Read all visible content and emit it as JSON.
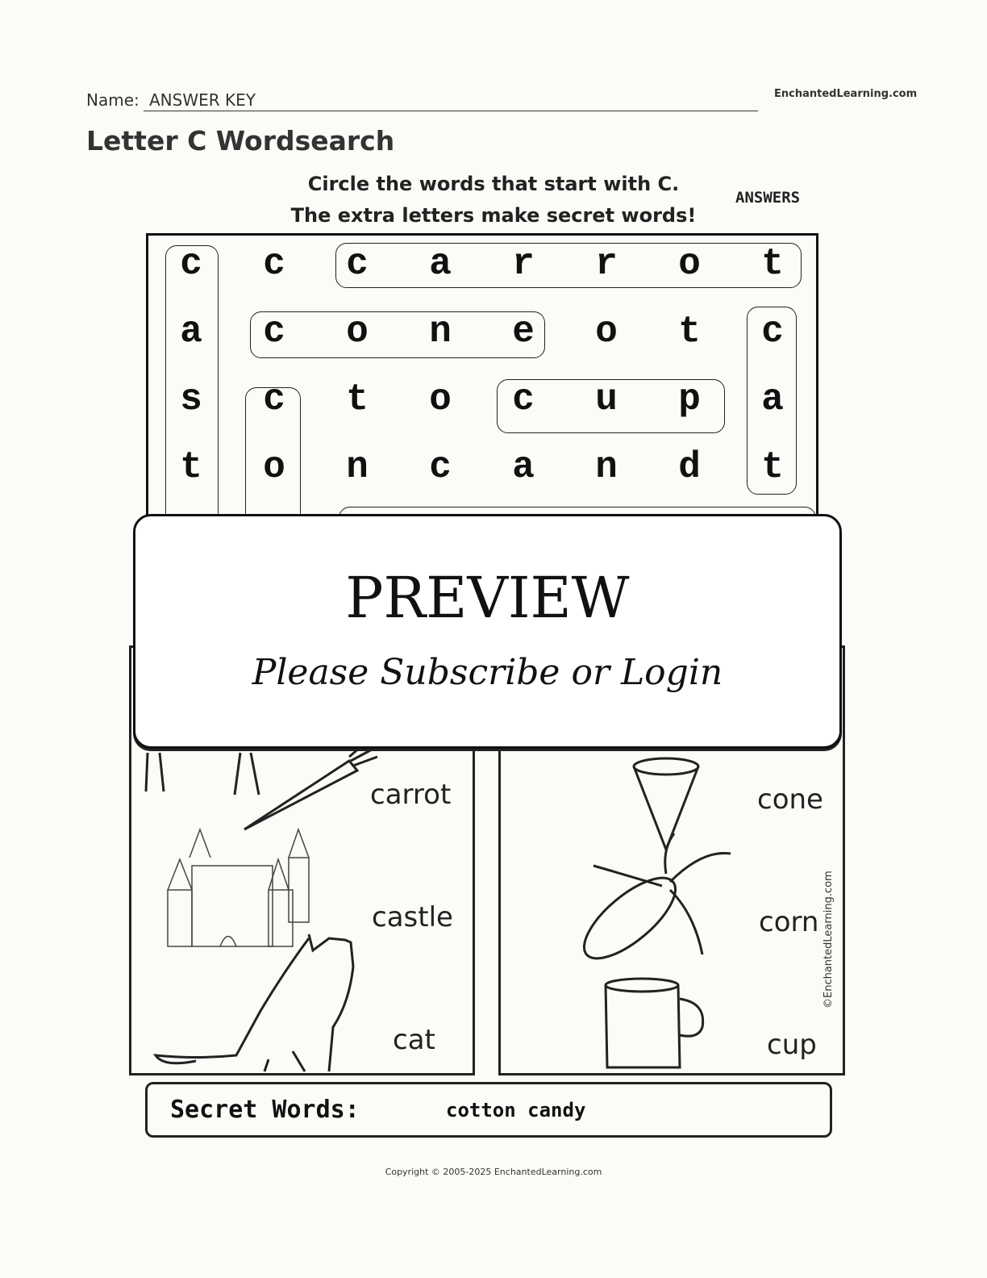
{
  "header": {
    "name_label": "Name:",
    "name_value": "ANSWER KEY",
    "site": "EnchantedLearning.com",
    "title": "Letter C Wordsearch"
  },
  "instructions": {
    "line1": "Circle the words that start with C.",
    "line2": "The extra letters make secret words!",
    "answers_label": "ANSWERS"
  },
  "grid": {
    "rows": [
      [
        "c",
        "c",
        "c",
        "a",
        "r",
        "r",
        "o",
        "t"
      ],
      [
        "a",
        "c",
        "o",
        "n",
        "e",
        "o",
        "t",
        "c"
      ],
      [
        "s",
        "c",
        "t",
        "o",
        "c",
        "u",
        "p",
        "a"
      ],
      [
        "t",
        "o",
        "n",
        "c",
        "a",
        "n",
        "d",
        "t"
      ]
    ]
  },
  "overlay": {
    "title": "PREVIEW",
    "subtitle": "Please Subscribe or Login"
  },
  "pictures": {
    "left": [
      "carrot",
      "castle",
      "cat"
    ],
    "right": [
      "cone",
      "corn",
      "cup"
    ],
    "credit": "©EnchantedLearning.com"
  },
  "secret": {
    "label": "Secret Words:",
    "value": "cotton candy"
  },
  "footer": {
    "copyright": "Copyright © 2005-2025 EnchantedLearning.com"
  }
}
